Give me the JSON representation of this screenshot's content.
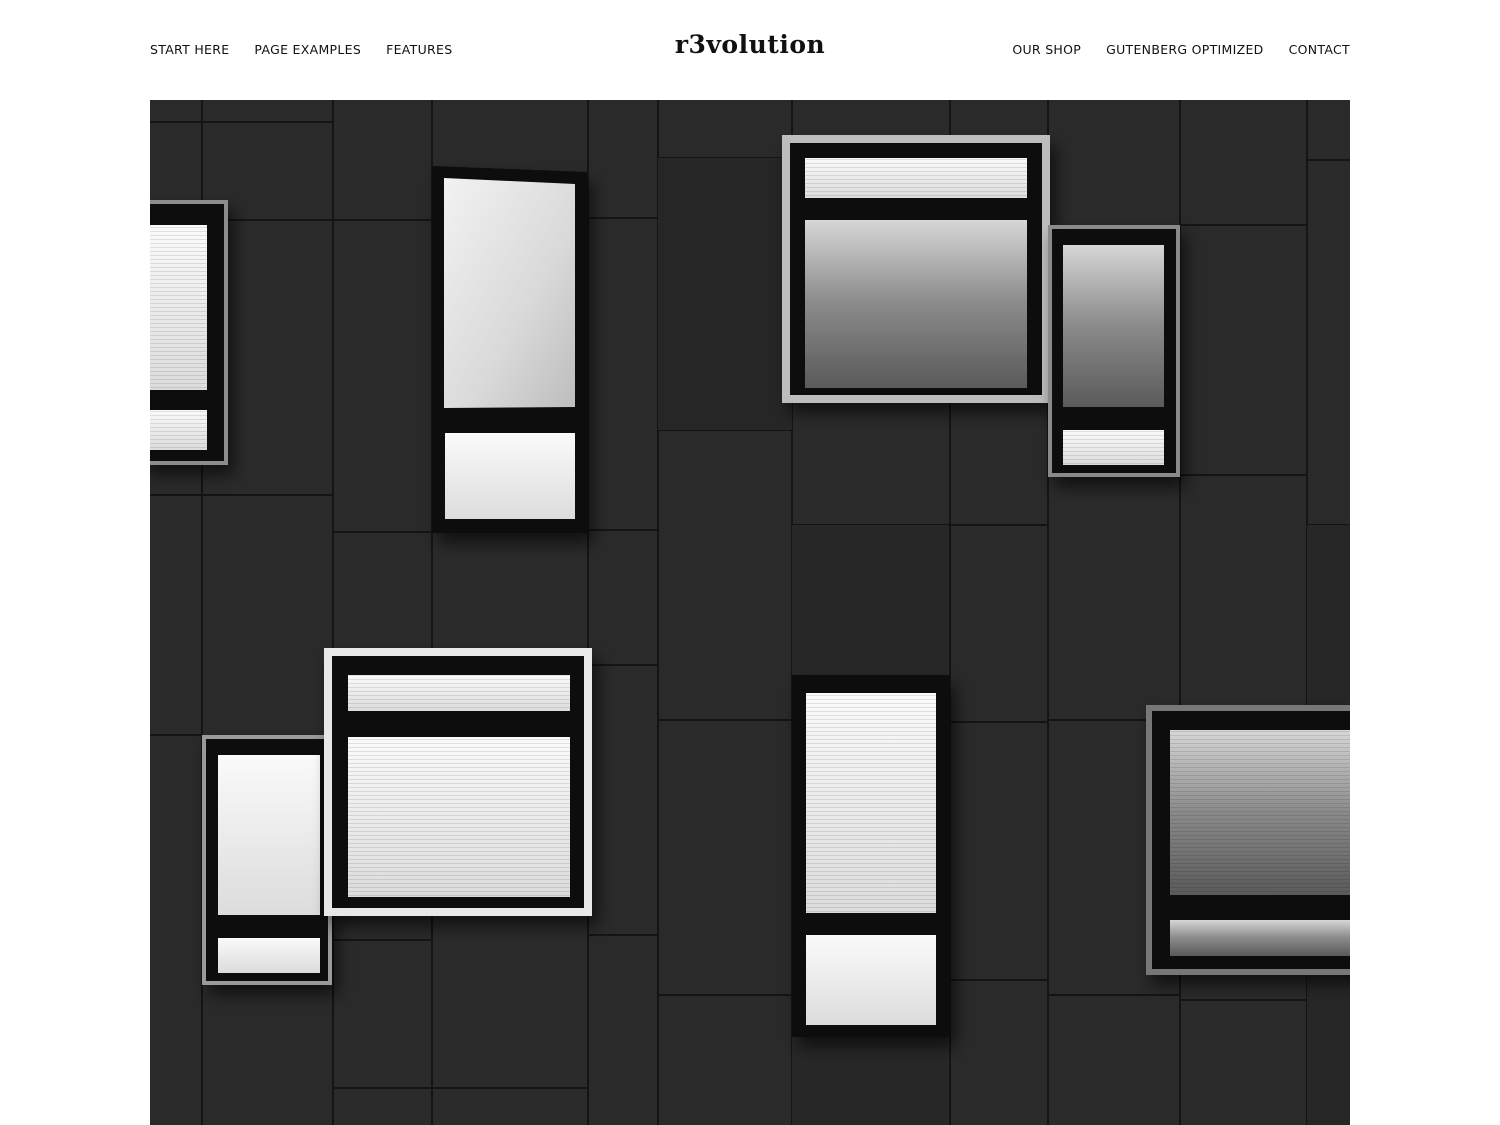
{
  "site": {
    "logo": "r3volution"
  },
  "nav": {
    "left": [
      {
        "label": "START HERE"
      },
      {
        "label": "PAGE EXAMPLES"
      },
      {
        "label": "FEATURES"
      }
    ],
    "right": [
      {
        "label": "OUR SHOP"
      },
      {
        "label": "GUTENBERG OPTIMIZED"
      },
      {
        "label": "CONTACT"
      }
    ]
  },
  "hero": {
    "image_subject": "black-and-white photo of a dark facade with offset framed windows"
  },
  "colors": {
    "background": "#ffffff",
    "text": "#111111",
    "facade": "#2a2a2a"
  }
}
